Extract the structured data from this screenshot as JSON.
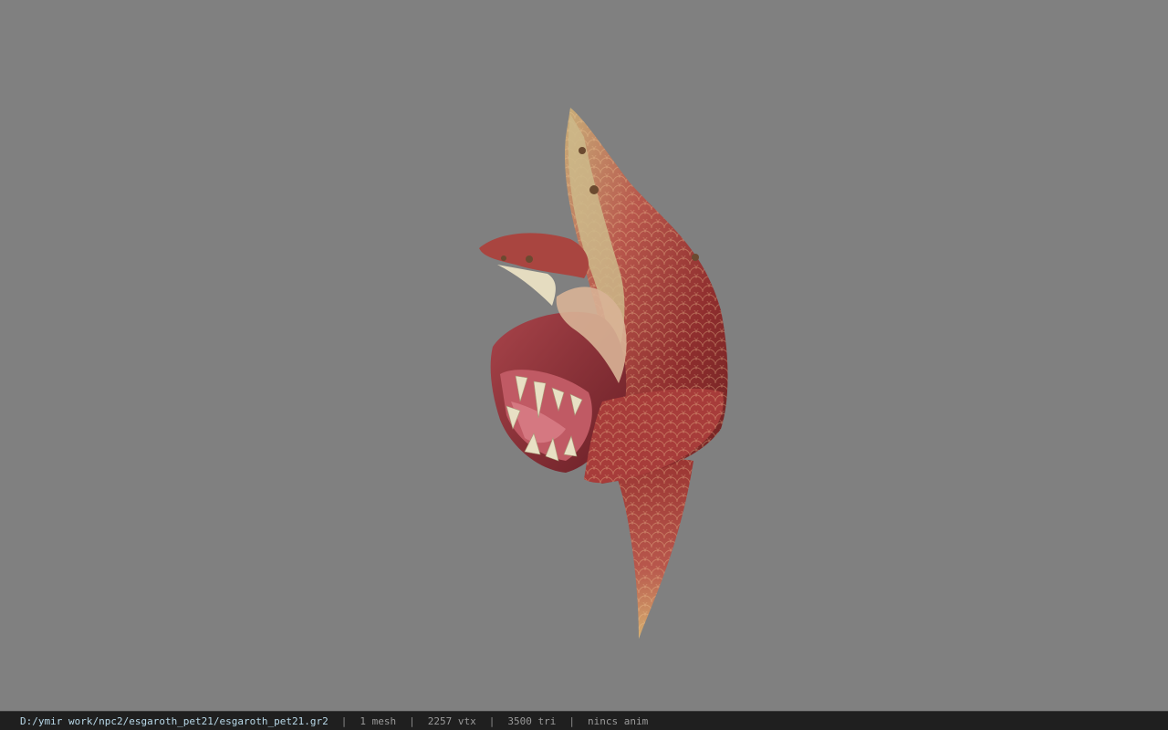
{
  "status_bar": {
    "file_path": "D:/ymir work/npc2/esgaroth_pet21/esgaroth_pet21.gr2",
    "separator": "|",
    "mesh_count": "1 mesh",
    "vertex_count": "2257 vtx",
    "triangle_count": "3500 tri",
    "animation": "nincs anim"
  },
  "colors": {
    "viewport_background": "#808080",
    "status_bar_background": "#1f1f1f",
    "path_text": "#b8d8e8",
    "stat_text": "#9a9a9a"
  },
  "viewport": {
    "model_subject": "red scaled fish-like creature with open toothed mouth"
  }
}
